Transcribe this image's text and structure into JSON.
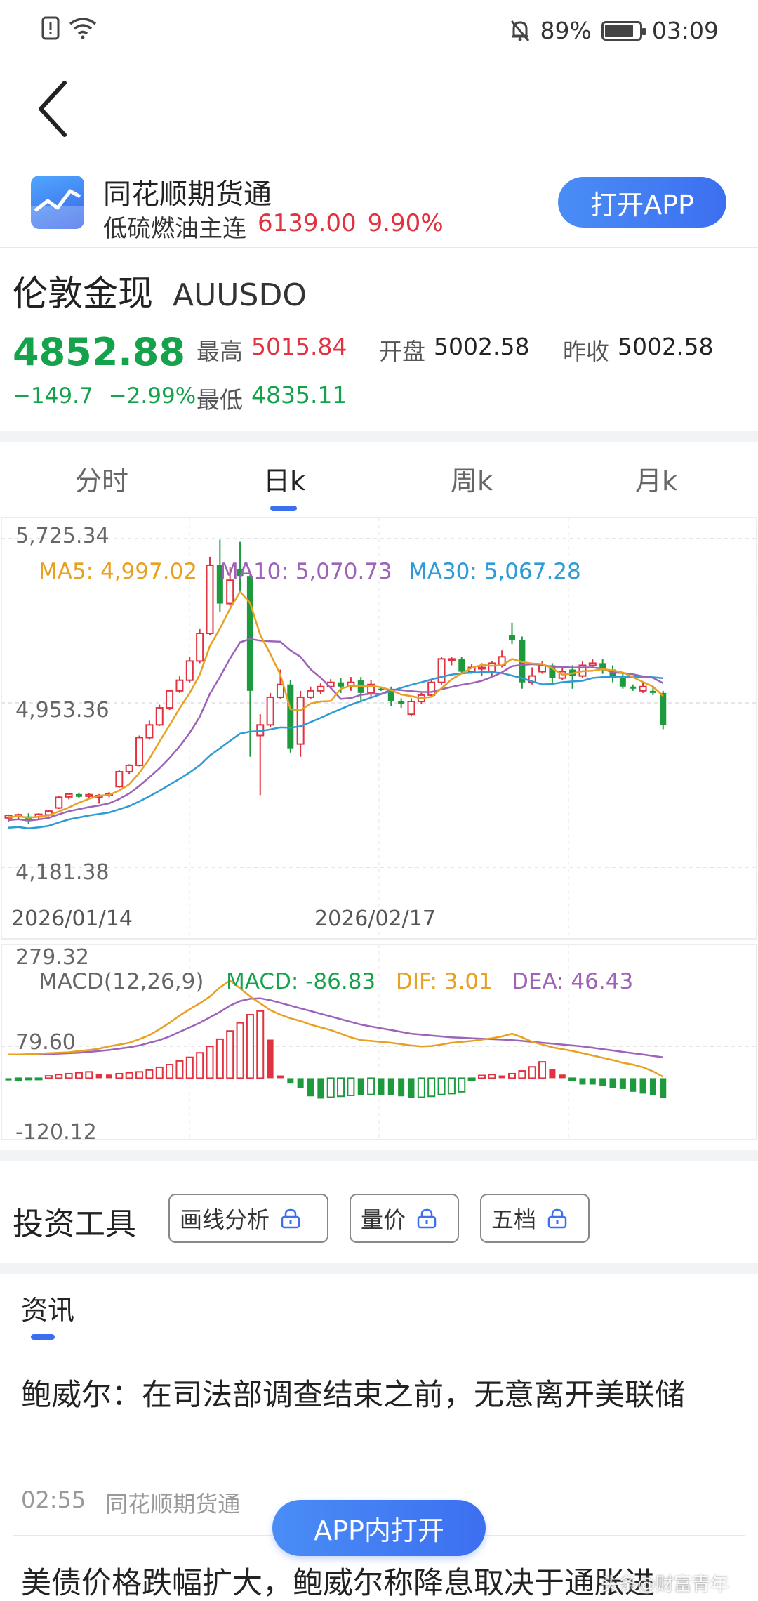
{
  "status_bar": {
    "battery": "89%",
    "time": "03:09"
  },
  "app_banner": {
    "name": "同花顺期货通",
    "contract": "低硫燃油主连",
    "contract_price": "6139.00",
    "contract_change": "9.90%",
    "open_label": "打开APP"
  },
  "quote": {
    "name": "伦敦金现",
    "code": "AUUSDO",
    "price": "4852.88",
    "change": "−149.7",
    "change_pct": "−2.99%",
    "high_label": "最高",
    "high": "5015.84",
    "open_label": "开盘",
    "open": "5002.58",
    "prev_label": "昨收",
    "prev": "5002.58",
    "low_label": "最低",
    "low": "4835.11"
  },
  "tabs": [
    "分时",
    "日k",
    "周k",
    "月k"
  ],
  "active_tab": "日k",
  "chart_data": [
    {
      "type": "candlestick",
      "y_ticks": [
        "5,725.34",
        "4,953.36",
        "4,181.38"
      ],
      "ylim": [
        4181.38,
        5725.34
      ],
      "x_labels": [
        "2026/01/14",
        "2026/02/17"
      ],
      "legend": [
        {
          "label": "MA5: 4,997.02",
          "color": "#e8a021"
        },
        {
          "label": "MA10: 5,070.73",
          "color": "#9c63b8"
        },
        {
          "label": "MA30: 5,067.28",
          "color": "#2f9bd6"
        }
      ],
      "candles": [
        [
          4413,
          4425,
          4395,
          4429
        ],
        [
          4420,
          4428,
          4405,
          4433
        ],
        [
          4420,
          4400,
          4385,
          4435
        ],
        [
          4418,
          4430,
          4408,
          4435
        ],
        [
          4427,
          4445,
          4420,
          4450
        ],
        [
          4460,
          4510,
          4455,
          4518
        ],
        [
          4512,
          4525,
          4500,
          4530
        ],
        [
          4525,
          4512,
          4505,
          4532
        ],
        [
          4515,
          4522,
          4500,
          4530
        ],
        [
          4510,
          4518,
          4480,
          4525
        ],
        [
          4520,
          4525,
          4510,
          4535
        ],
        [
          4560,
          4630,
          4555,
          4640
        ],
        [
          4630,
          4660,
          4620,
          4665
        ],
        [
          4660,
          4790,
          4655,
          4800
        ],
        [
          4790,
          4850,
          4780,
          4870
        ],
        [
          4850,
          4930,
          4845,
          4945
        ],
        [
          4930,
          5010,
          4920,
          5015
        ],
        [
          5010,
          5060,
          5000,
          5078
        ],
        [
          5060,
          5150,
          5050,
          5170
        ],
        [
          5150,
          5280,
          5140,
          5300
        ],
        [
          5280,
          5600,
          5270,
          5640
        ],
        [
          5600,
          5420,
          5380,
          5720
        ],
        [
          5420,
          5530,
          5410,
          5590
        ],
        [
          5580,
          5550,
          5480,
          5710
        ],
        [
          5550,
          5010,
          4700,
          5560
        ],
        [
          4800,
          4850,
          4520,
          4900
        ],
        [
          4850,
          4980,
          4840,
          5000
        ],
        [
          4980,
          5040,
          4970,
          5110
        ],
        [
          5040,
          4740,
          4720,
          5060
        ],
        [
          4760,
          4980,
          4700,
          5010
        ],
        [
          4980,
          5010,
          4970,
          5030
        ],
        [
          5010,
          5030,
          4995,
          5045
        ],
        [
          5030,
          5050,
          5020,
          5065
        ],
        [
          5050,
          5030,
          5000,
          5070
        ],
        [
          5030,
          5050,
          5010,
          5075
        ],
        [
          5060,
          5000,
          4960,
          5075
        ],
        [
          5000,
          5040,
          4980,
          5060
        ],
        [
          5020,
          5015,
          5010,
          5030
        ],
        [
          5010,
          4960,
          4940,
          5030
        ],
        [
          4960,
          4950,
          4930,
          4975
        ],
        [
          4900,
          4960,
          4890,
          4975
        ],
        [
          4960,
          4990,
          4950,
          5000
        ],
        [
          4990,
          5050,
          4980,
          5060
        ],
        [
          5050,
          5160,
          5040,
          5170
        ],
        [
          5160,
          5160,
          5130,
          5170
        ],
        [
          5160,
          5100,
          5090,
          5170
        ],
        [
          5100,
          5120,
          5090,
          5135
        ],
        [
          5120,
          5120,
          5080,
          5140
        ],
        [
          5100,
          5140,
          5080,
          5150
        ],
        [
          5130,
          5170,
          5120,
          5200
        ],
        [
          5270,
          5250,
          5230,
          5330
        ],
        [
          5250,
          5050,
          5020,
          5265
        ],
        [
          5050,
          5080,
          5040,
          5120
        ],
        [
          5100,
          5130,
          5090,
          5150
        ],
        [
          5130,
          5070,
          5040,
          5140
        ],
        [
          5070,
          5100,
          5060,
          5120
        ],
        [
          5110,
          5080,
          5020,
          5130
        ],
        [
          5080,
          5130,
          5070,
          5150
        ],
        [
          5130,
          5140,
          5120,
          5160
        ],
        [
          5140,
          5110,
          5090,
          5160
        ],
        [
          5110,
          5070,
          5050,
          5130
        ],
        [
          5070,
          5030,
          5020,
          5090
        ],
        [
          5030,
          5020,
          5010,
          5040
        ],
        [
          5010,
          5030,
          5000,
          5050
        ],
        [
          5010,
          5000,
          4990,
          5030
        ],
        [
          5000,
          4850,
          4830,
          5010
        ]
      ]
    },
    {
      "type": "macd",
      "y_ticks": [
        "279.32",
        "79.60",
        "-120.12"
      ],
      "ylim": [
        -120.12,
        279.32
      ],
      "legend": [
        {
          "label": "MACD(12,26,9)",
          "color": "#666666"
        },
        {
          "label": "MACD: -86.83",
          "color": "#14a24b"
        },
        {
          "label": "DIF: 3.01",
          "color": "#e8a021"
        },
        {
          "label": "DEA: 46.43",
          "color": "#9c63b8"
        }
      ],
      "hist": [
        -5,
        -4,
        -3,
        -2,
        5,
        8,
        10,
        12,
        14,
        10,
        8,
        10,
        12,
        14,
        18,
        24,
        30,
        38,
        46,
        56,
        70,
        86,
        104,
        122,
        140,
        148,
        85,
        6,
        -12,
        -22,
        -40,
        -45,
        -42,
        -40,
        -38,
        -38,
        -36,
        -38,
        -38,
        -40,
        -44,
        -42,
        -40,
        -36,
        -34,
        -30,
        -4,
        6,
        8,
        6,
        10,
        16,
        25,
        36,
        20,
        8,
        -4,
        -14,
        -14,
        -18,
        -22,
        -24,
        -30,
        -34,
        -38,
        -44
      ],
      "dif": [
        52,
        52,
        53,
        54,
        55,
        56,
        57,
        60,
        62,
        65,
        70,
        74,
        78,
        86,
        95,
        108,
        122,
        138,
        152,
        165,
        180,
        200,
        215,
        198,
        180,
        165,
        150,
        140,
        132,
        126,
        118,
        112,
        106,
        98,
        90,
        84,
        82,
        80,
        78,
        75,
        72,
        70,
        71,
        74,
        78,
        80,
        82,
        85,
        88,
        92,
        98,
        90,
        80,
        74,
        68,
        64,
        60,
        55,
        50,
        45,
        40,
        34,
        30,
        24,
        15,
        3
      ],
      "dea": [
        52,
        52,
        52,
        53,
        53,
        54,
        55,
        56,
        58,
        60,
        62,
        65,
        68,
        72,
        78,
        84,
        92,
        102,
        112,
        122,
        134,
        146,
        160,
        170,
        175,
        176,
        172,
        166,
        160,
        154,
        148,
        142,
        136,
        130,
        124,
        118,
        114,
        110,
        106,
        102,
        98,
        96,
        94,
        92,
        90,
        89,
        88,
        87,
        86,
        85,
        84,
        82,
        80,
        78,
        76,
        74,
        72,
        70,
        67,
        64,
        61,
        58,
        55,
        52,
        49,
        46
      ]
    }
  ],
  "tools": {
    "title": "投资工具",
    "buttons": [
      "画线分析",
      "量价",
      "五档"
    ]
  },
  "news": {
    "tab": "资讯",
    "items": [
      {
        "title": "鲍威尔：在司法部调查结束之前，无意离开美联储",
        "time": "02:55",
        "source": "同花顺期货通"
      },
      {
        "title": "美债价格跌幅扩大，鲍威尔称降息取决于通胀进"
      }
    ],
    "float_button": "APP内打开",
    "watermark": "头条@财富青年"
  }
}
